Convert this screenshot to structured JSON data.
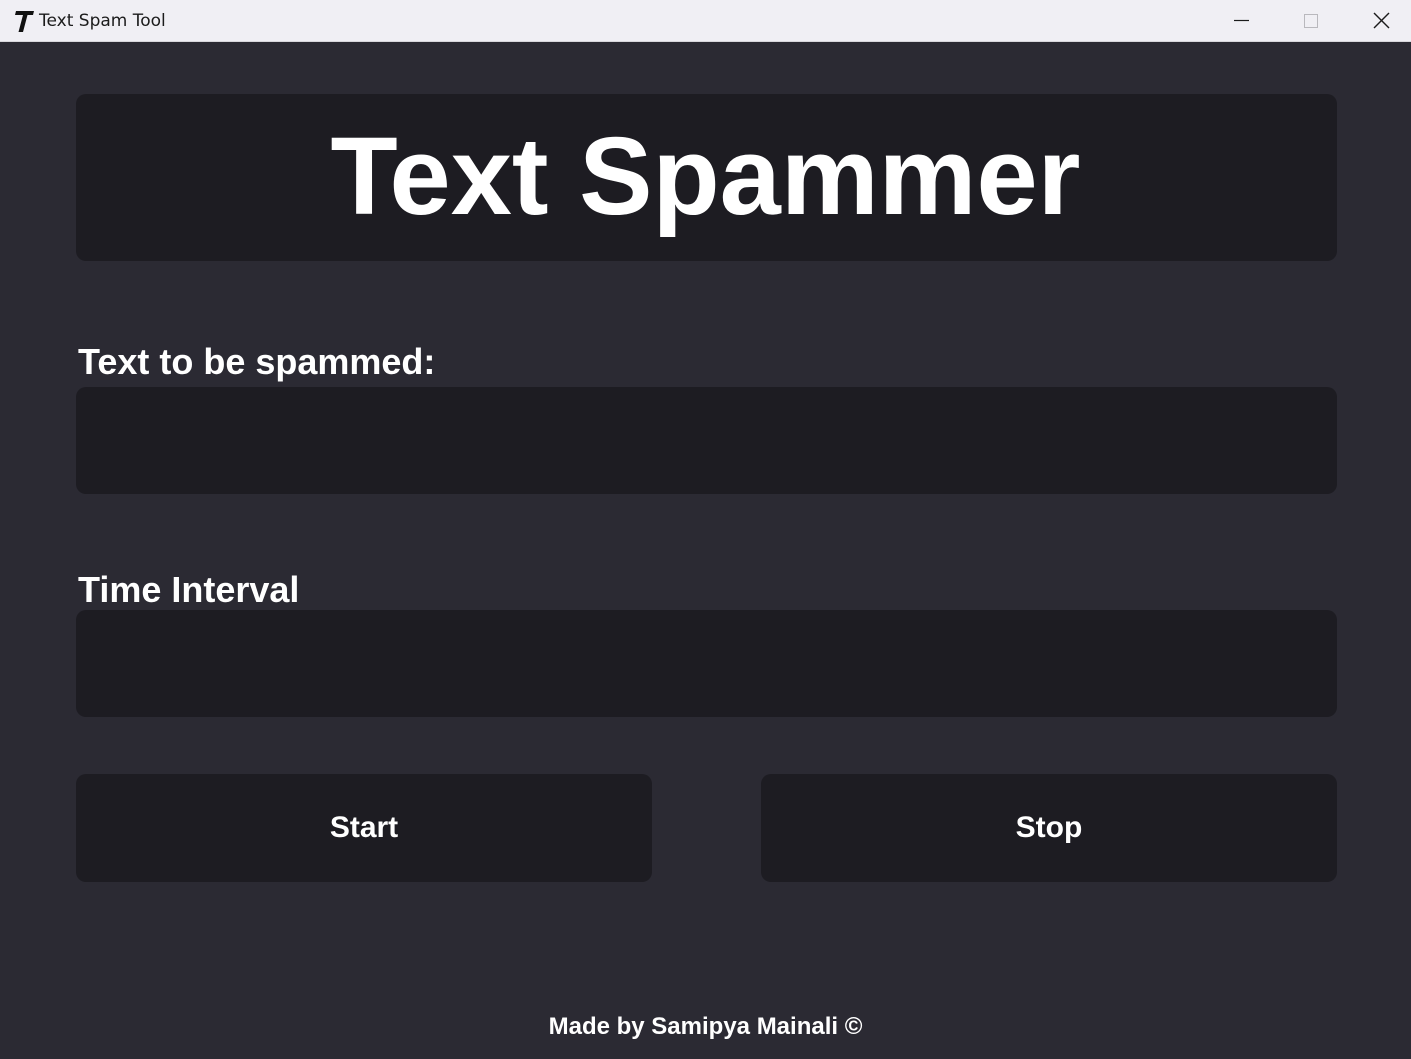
{
  "window": {
    "title": "Text Spam Tool",
    "icon": "letter-t-icon"
  },
  "header": {
    "title": "Text Spammer"
  },
  "form": {
    "text_label": "Text to be spammed:",
    "text_value": "",
    "interval_label": "Time Interval",
    "interval_value": ""
  },
  "buttons": {
    "start_label": "Start",
    "stop_label": "Stop"
  },
  "footer": {
    "credit": "Made by Samipya Mainali ©"
  },
  "colors": {
    "background": "#2b2a33",
    "panel": "#1d1c22",
    "text": "#ffffff",
    "titlebar": "#f0eff4"
  }
}
